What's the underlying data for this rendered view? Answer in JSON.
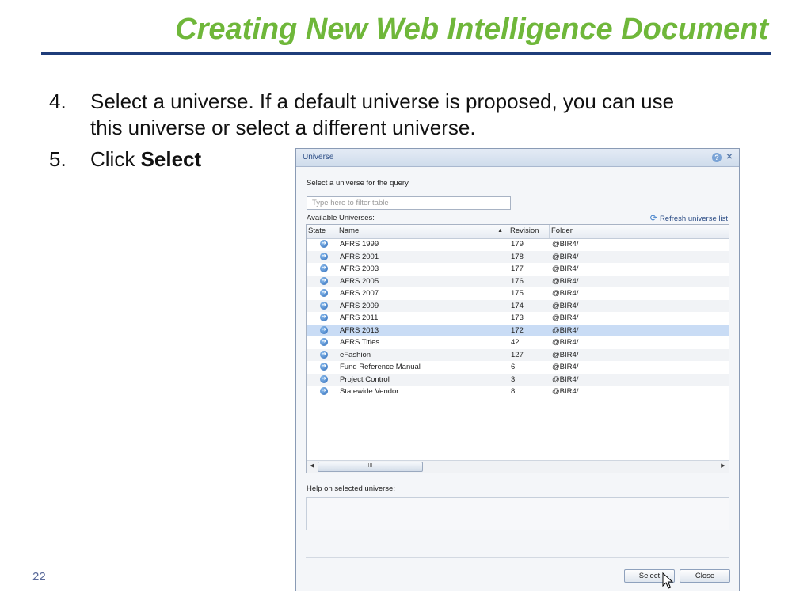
{
  "slide": {
    "title": "Creating New Web Intelligence Document",
    "steps": [
      {
        "num": "4.",
        "lines": [
          "Select a universe. If a default universe is proposed, you can use",
          "this universe or select a different universe."
        ]
      },
      {
        "num": "5.",
        "prefix": "Click ",
        "bold": "Select"
      }
    ],
    "page_number": "22"
  },
  "dialog": {
    "title": "Universe",
    "prompt": "Select a universe for the query.",
    "filter_placeholder": "Type here to filter table",
    "available_label": "Available Universes:",
    "refresh_label": "Refresh universe list",
    "columns": [
      "State",
      "Name",
      "Revision",
      "Folder"
    ],
    "rows": [
      {
        "name": "AFRS 1999",
        "revision": "179",
        "folder": "@BIR4/"
      },
      {
        "name": "AFRS 2001",
        "revision": "178",
        "folder": "@BIR4/"
      },
      {
        "name": "AFRS 2003",
        "revision": "177",
        "folder": "@BIR4/"
      },
      {
        "name": "AFRS 2005",
        "revision": "176",
        "folder": "@BIR4/"
      },
      {
        "name": "AFRS 2007",
        "revision": "175",
        "folder": "@BIR4/"
      },
      {
        "name": "AFRS 2009",
        "revision": "174",
        "folder": "@BIR4/"
      },
      {
        "name": "AFRS 2011",
        "revision": "173",
        "folder": "@BIR4/"
      },
      {
        "name": "AFRS 2013",
        "revision": "172",
        "folder": "@BIR4/",
        "selected": true
      },
      {
        "name": "AFRS Titles",
        "revision": "42",
        "folder": "@BIR4/"
      },
      {
        "name": "eFashion",
        "revision": "127",
        "folder": "@BIR4/"
      },
      {
        "name": "Fund Reference Manual",
        "revision": "6",
        "folder": "@BIR4/"
      },
      {
        "name": "Project Control",
        "revision": "3",
        "folder": "@BIR4/"
      },
      {
        "name": "Statewide Vendor",
        "revision": "8",
        "folder": "@BIR4/"
      }
    ],
    "scroll_thumb_label": "III",
    "help_label": "Help on selected universe:",
    "select_button": "Select",
    "close_button": "Close"
  },
  "icons": {
    "state": "universe-state-icon",
    "refresh": "refresh-icon",
    "help": "help-icon",
    "close": "close-icon",
    "sort": "sort-ascending-icon",
    "cursor": "mouse-pointer-icon"
  },
  "colors": {
    "title": "#6fb73a",
    "rule": "#1f3d7a",
    "selected_row": "#c9dcf5",
    "dialog_title_text": "#2c4d86"
  }
}
